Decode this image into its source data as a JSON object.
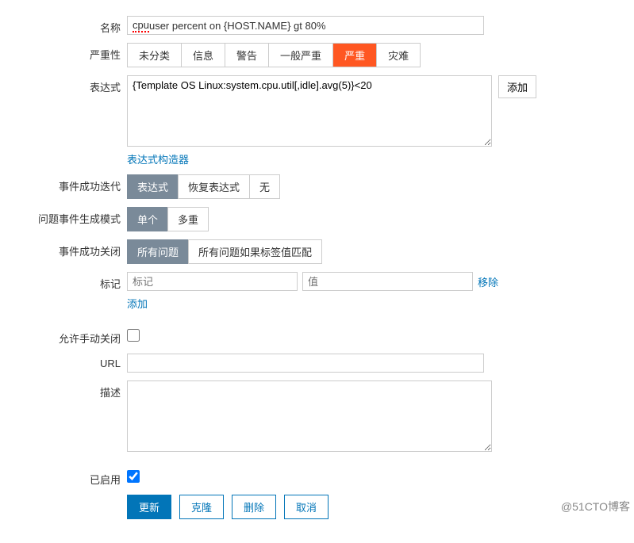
{
  "labels": {
    "name": "名称",
    "severity": "严重性",
    "expression": "表达式",
    "event_success_iterate": "事件成功迭代",
    "problem_event_mode": "问题事件生成模式",
    "event_success_close": "事件成功关闭",
    "tags": "标记",
    "allow_manual_close": "允许手动关闭",
    "url": "URL",
    "description": "描述",
    "enabled": "已启用"
  },
  "fields": {
    "name_value": "cpu user percent on {HOST.NAME} gt 80%",
    "name_prefix": "cpu",
    "name_rest": " user percent on {HOST.NAME} gt 80%",
    "expression_value": "{Template OS Linux:system.cpu.util[,idle].avg(5)}<20",
    "url_value": "",
    "description_value": ""
  },
  "severity": {
    "options": [
      "未分类",
      "信息",
      "警告",
      "一般严重",
      "严重",
      "灾难"
    ],
    "selected": 4
  },
  "expression_actions": {
    "add": "添加",
    "constructor": "表达式构造器"
  },
  "event_success_iterate": {
    "options": [
      "表达式",
      "恢复表达式",
      "无"
    ],
    "selected": 0
  },
  "problem_event_mode": {
    "options": [
      "单个",
      "多重"
    ],
    "selected": 0
  },
  "event_success_close": {
    "options": [
      "所有问题",
      "所有问题如果标签值匹配"
    ],
    "selected": 0
  },
  "tags": {
    "name_placeholder": "标记",
    "value_placeholder": "值",
    "remove": "移除",
    "add": "添加"
  },
  "allow_manual_close": false,
  "enabled": true,
  "buttons": {
    "update": "更新",
    "clone": "克隆",
    "delete": "删除",
    "cancel": "取消"
  },
  "watermark": "@51CTO博客"
}
